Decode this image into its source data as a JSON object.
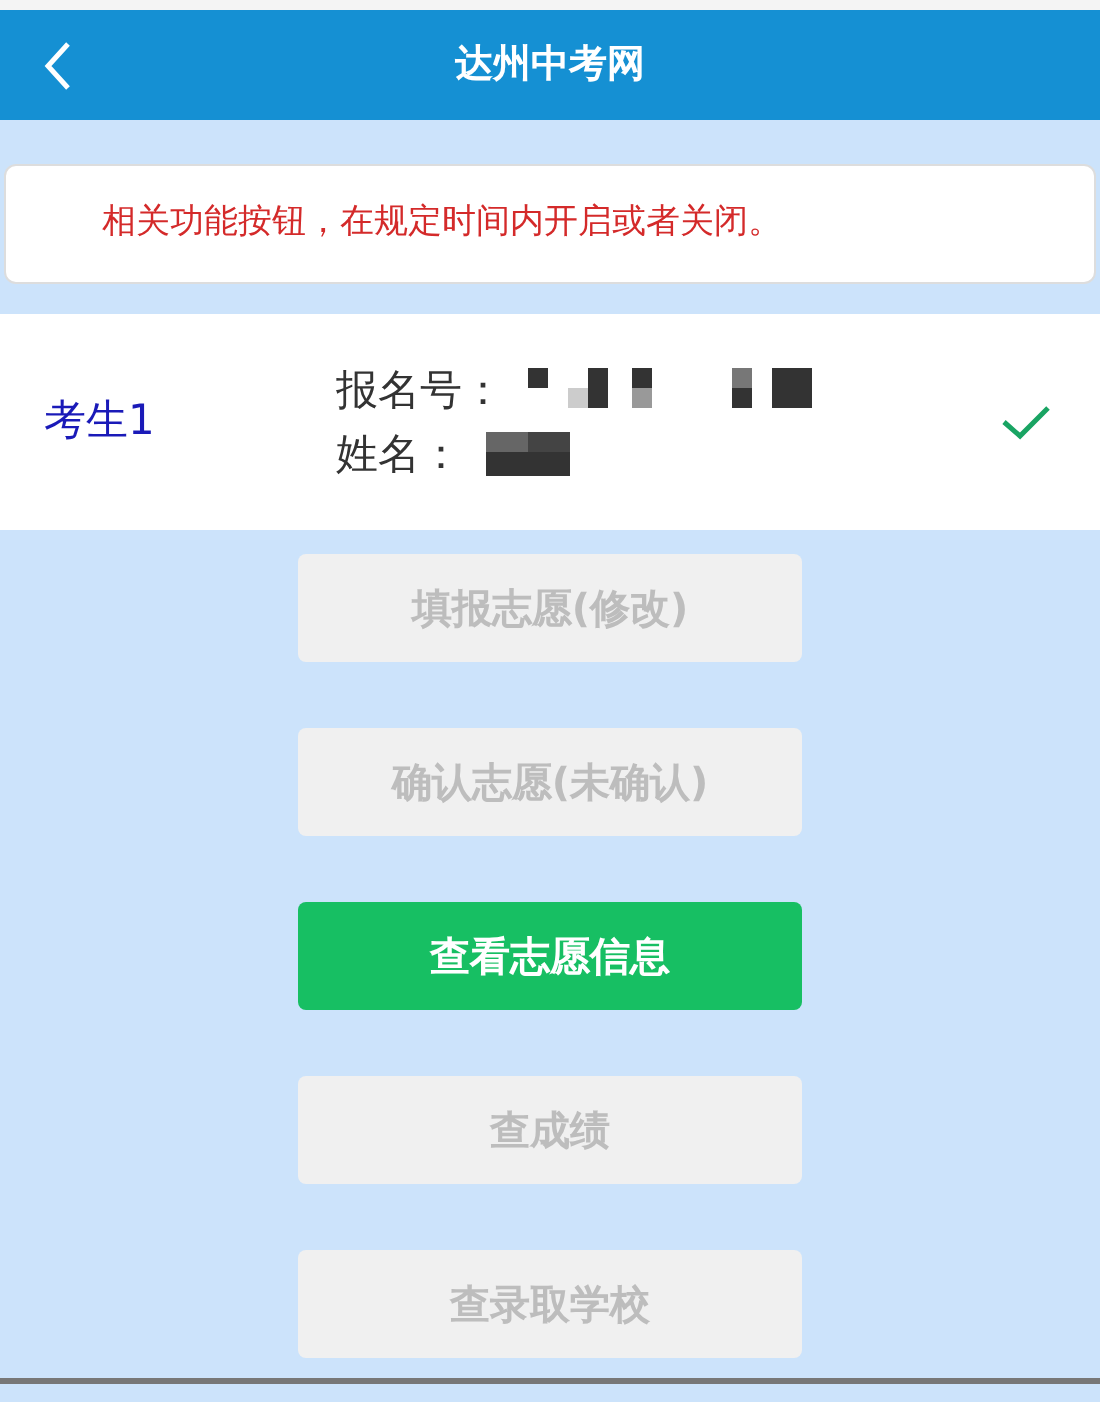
{
  "header": {
    "title": "达州中考网"
  },
  "notice": "相关功能按钮，在规定时间内开启或者关闭。",
  "student": {
    "label": "考生1",
    "reg_label": "报名号：",
    "name_label": "姓名：",
    "checked": true
  },
  "buttons": [
    {
      "label": "填报志愿(修改)",
      "disabled": true
    },
    {
      "label": "确认志愿(未确认)",
      "disabled": true
    },
    {
      "label": "查看志愿信息",
      "disabled": false
    },
    {
      "label": "查成绩",
      "disabled": true
    },
    {
      "label": "查录取学校",
      "disabled": true
    }
  ]
}
